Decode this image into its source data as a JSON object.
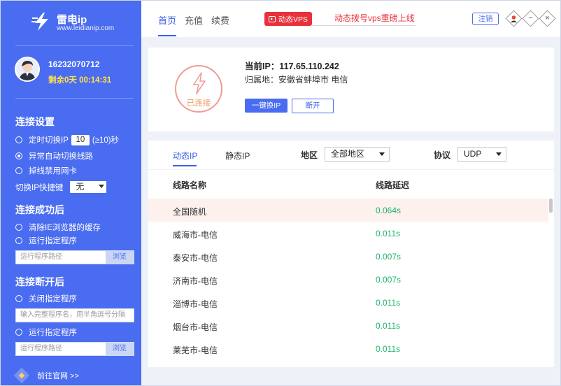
{
  "app": {
    "logo": {
      "name": "雷电ip",
      "url": "www.leidianip.com"
    },
    "user": {
      "id": "16232070712",
      "remaining": "剩余0天 00:14:31"
    }
  },
  "sidebar": {
    "connect_settings": {
      "title": "连接设置",
      "timed_switch_prefix": "定时切换IP",
      "timed_switch_value": "10",
      "timed_switch_suffix": "(≥10)秒",
      "auto_switch_label": "异常自动切换线路",
      "disable_nic_label": "掉线禁用网卡",
      "hotkey_label": "切换IP快捷键",
      "hotkey_value": "无"
    },
    "after_connect": {
      "title": "连接成功后",
      "clear_cache_label": "清除IE浏览器的缓存",
      "run_program_label": "运行指定程序",
      "path_placeholder": "运行程序路径",
      "browse_label": "浏览"
    },
    "after_disconnect": {
      "title": "连接断开后",
      "close_program_label": "关闭指定程序",
      "close_program_placeholder": "输入完整程序名，用半角逗号分隔",
      "run_program_label": "运行指定程序",
      "path_placeholder": "运行程序路径",
      "browse_label": "浏览"
    },
    "official_link": "前往官网 >>"
  },
  "topbar": {
    "tabs": [
      "首页",
      "充值",
      "续费"
    ],
    "vps_badge": "动态VPS",
    "marquee": "动态拨号vps重磅上线",
    "logout": "注销",
    "minimize": "−",
    "close": "×"
  },
  "status": {
    "state": "已连接",
    "current_ip": "当前IP：117.65.110.242",
    "location": "归属地：安徽省蚌埠市 电信",
    "switch_button": "一键换IP",
    "disconnect_button": "断开"
  },
  "filters": {
    "tabs": [
      "动态IP",
      "静态IP"
    ],
    "region_label": "地区",
    "region_value": "全部地区",
    "protocol_label": "协议",
    "protocol_value": "UDP"
  },
  "list": {
    "headers": [
      "线路名称",
      "线路延迟"
    ],
    "rows": [
      {
        "name": "全国随机",
        "latency": "0.064s"
      },
      {
        "name": "威海市-电信",
        "latency": "0.011s"
      },
      {
        "name": "泰安市-电信",
        "latency": "0.007s"
      },
      {
        "name": "济南市-电信",
        "latency": "0.007s"
      },
      {
        "name": "淄博市-电信",
        "latency": "0.011s"
      },
      {
        "name": "烟台市-电信",
        "latency": "0.011s"
      },
      {
        "name": "莱芜市-电信",
        "latency": "0.011s"
      }
    ]
  },
  "colors": {
    "sidebar": "#4a6cf0",
    "accent": "#3b5fe8",
    "danger": "#e8313b",
    "latency": "#1fb36b"
  }
}
